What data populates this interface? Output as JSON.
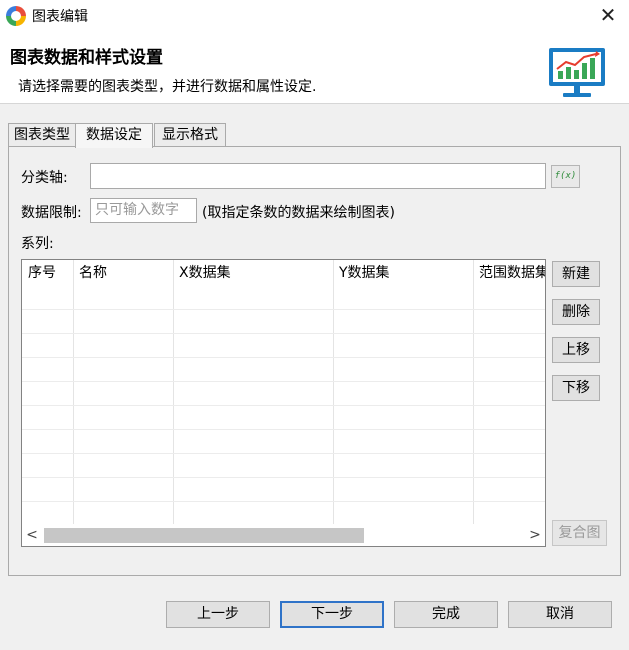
{
  "window": {
    "title": "图表编辑",
    "close_glyph": "✕"
  },
  "header": {
    "title": "图表数据和样式设置",
    "subtitle": "请选择需要的图表类型，并进行数据和属性设定."
  },
  "tabs": [
    {
      "label": "图表类型",
      "active": false
    },
    {
      "label": "数据设定",
      "active": true
    },
    {
      "label": "显示格式",
      "active": false
    }
  ],
  "form": {
    "category_axis_label": "分类轴:",
    "category_axis_value": "",
    "fx_button_label": "f(x)",
    "data_limit_label": "数据限制:",
    "data_limit_placeholder": "只可输入数字",
    "data_limit_hint": "(取指定条数的数据来绘制图表)",
    "series_label": "系列:"
  },
  "series_table": {
    "columns": [
      "序号",
      "名称",
      "X数据集",
      "Y数据集",
      "范围数据集"
    ],
    "rows": []
  },
  "side_buttons": [
    {
      "label": "新建",
      "enabled": true
    },
    {
      "label": "删除",
      "enabled": true
    },
    {
      "label": "上移",
      "enabled": true
    },
    {
      "label": "下移",
      "enabled": true
    },
    {
      "label": "复合图",
      "enabled": false
    }
  ],
  "footer": {
    "prev": "上一步",
    "next": "下一步",
    "finish": "完成",
    "cancel": "取消"
  },
  "colors": {
    "accent": "#2f73c8",
    "icon_green": "#3aa757"
  }
}
